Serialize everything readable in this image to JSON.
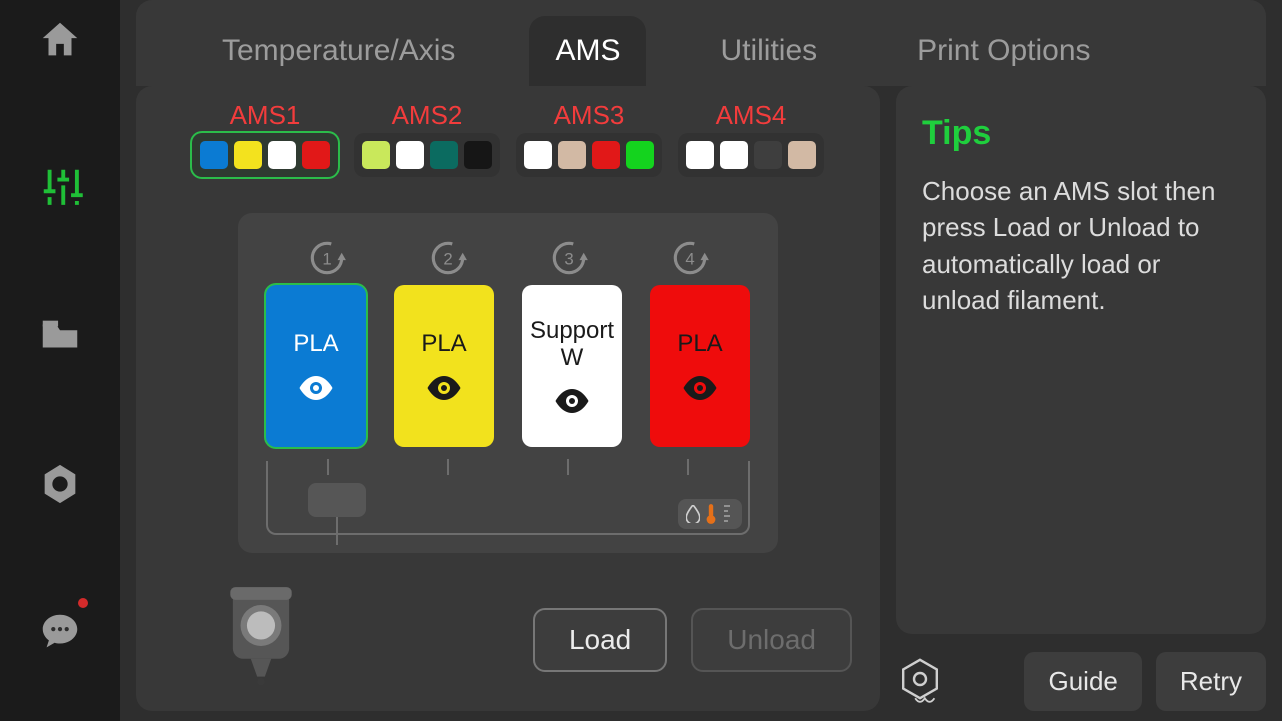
{
  "sidebar": {
    "items": [
      "home",
      "controls",
      "files",
      "settings",
      "chat"
    ],
    "active": 1,
    "chat_notification": true
  },
  "tabs": {
    "items": [
      "Temperature/Axis",
      "AMS",
      "Utilities",
      "Print Options"
    ],
    "active": 1
  },
  "ams_units": [
    {
      "label": "AMS1",
      "selected": true,
      "colors": [
        "#0b7bd3",
        "#f3e21e",
        "#ffffff",
        "#e11818"
      ]
    },
    {
      "label": "AMS2",
      "selected": false,
      "colors": [
        "#c9e85b",
        "#ffffff",
        "#0b6b60",
        "#161616"
      ]
    },
    {
      "label": "AMS3",
      "selected": false,
      "colors": [
        "#ffffff",
        "#d2b9a4",
        "#e11818",
        "#14d31e"
      ]
    },
    {
      "label": "AMS4",
      "selected": false,
      "colors": [
        "#ffffff",
        "#ffffff",
        "#3e3e3e",
        "#d2b9a4"
      ]
    }
  ],
  "slots": [
    {
      "index": 1,
      "material": "PLA",
      "color": "#0b7bd3",
      "text": "#ffffff",
      "selected": true
    },
    {
      "index": 2,
      "material": "PLA",
      "color": "#f2e21d",
      "text": "#1a1a1a",
      "selected": false
    },
    {
      "index": 3,
      "material": "Support W",
      "color": "#ffffff",
      "text": "#1a1a1a",
      "selected": false
    },
    {
      "index": 4,
      "material": "PLA",
      "color": "#ef0c0c",
      "text": "#1a1a1a",
      "selected": false
    }
  ],
  "buttons": {
    "load": {
      "label": "Load",
      "enabled": true
    },
    "unload": {
      "label": "Unload",
      "enabled": false
    }
  },
  "tips": {
    "title": "Tips",
    "body": "Choose an AMS slot then press Load or Unload to automatically load or unload filament."
  },
  "footer": {
    "guide": "Guide",
    "retry": "Retry"
  }
}
